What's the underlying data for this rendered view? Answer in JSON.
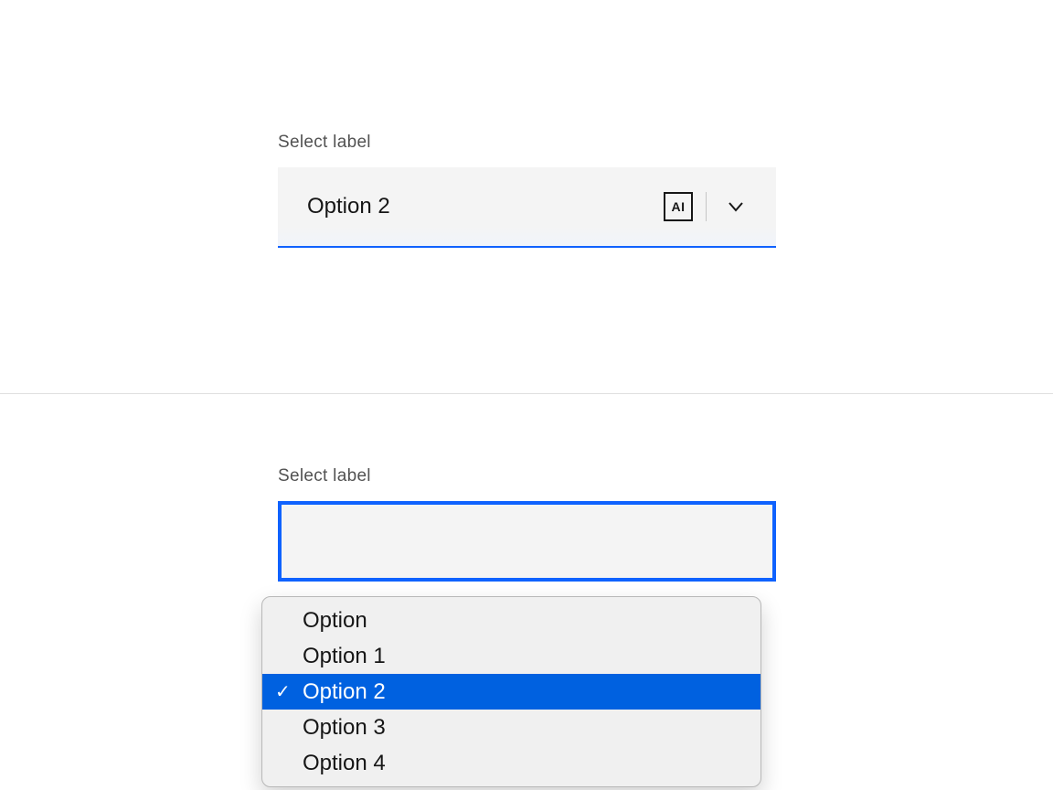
{
  "select1": {
    "label": "Select label",
    "value": "Option 2",
    "ai_badge": "AI"
  },
  "select2": {
    "label": "Select label",
    "options": [
      {
        "label": "Option",
        "selected": false
      },
      {
        "label": "Option 1",
        "selected": false
      },
      {
        "label": "Option 2",
        "selected": true
      },
      {
        "label": "Option 3",
        "selected": false
      },
      {
        "label": "Option 4",
        "selected": false
      }
    ]
  }
}
